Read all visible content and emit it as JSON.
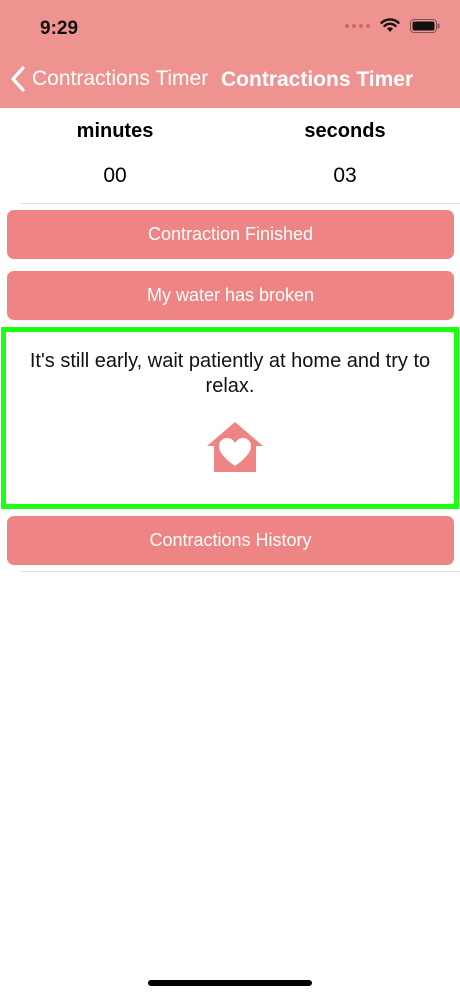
{
  "status_bar": {
    "time": "9:29"
  },
  "nav": {
    "back_label": "Contractions Timer",
    "title": "Contractions Timer"
  },
  "timer": {
    "minutes_label": "minutes",
    "seconds_label": "seconds",
    "minutes_value": "00",
    "seconds_value": "03"
  },
  "buttons": {
    "contraction_finished": "Contraction Finished",
    "water_broken": "My water has broken",
    "history": "Contractions History"
  },
  "advice": {
    "message": "It's still early, wait patiently at home and try to relax.",
    "icon": "house-heart-icon"
  },
  "colors": {
    "header": "#ef9390",
    "button": "#ee8483",
    "highlight_border": "#1bff11"
  }
}
